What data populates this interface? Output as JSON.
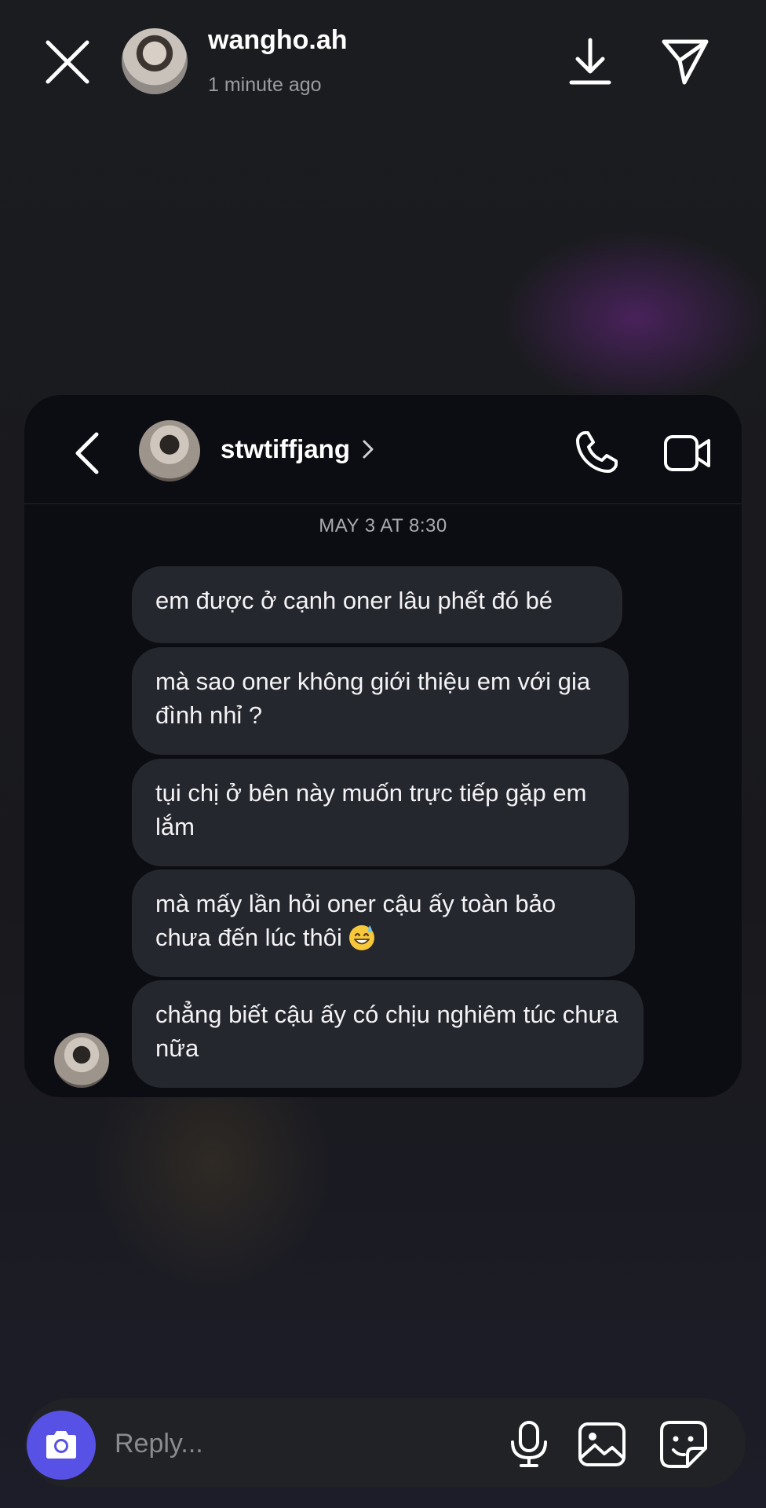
{
  "story": {
    "username": "wangho.ah",
    "time_ago": "1 minute ago"
  },
  "dm": {
    "contact_name": "stwtiffjang",
    "date_label": "MAY 3 AT 8:30",
    "messages": [
      {
        "text": "em được ở cạnh oner lâu phết đó bé"
      },
      {
        "text": "mà sao oner không giới thiệu em với gia đình nhỉ ?"
      },
      {
        "text": "tụi chị ở bên này muốn trực tiếp gặp em lắm"
      },
      {
        "text": "mà mấy lần hỏi oner cậu ấy toàn bảo chưa đến lúc thôi",
        "emoji": "grinning-face-with-sweat"
      },
      {
        "text": "chẳng biết cậu ấy có chịu nghiêm túc chưa nữa"
      }
    ]
  },
  "reply": {
    "placeholder": "Reply..."
  },
  "icons": {
    "close": "close-icon",
    "download": "download-icon",
    "send": "send-icon",
    "back": "back-chevron-icon",
    "profile_chevron": "chevron-right-icon",
    "call": "phone-icon",
    "video": "video-camera-icon",
    "camera": "camera-icon",
    "mic": "microphone-icon",
    "gallery": "image-gallery-icon",
    "sticker": "sticker-icon"
  },
  "colors": {
    "background": "#1b1c1f",
    "card": "#0c0d12",
    "bubble": "#25272e",
    "accent_camera": "#5851e6",
    "secondary_text": "#9b9ba0"
  }
}
